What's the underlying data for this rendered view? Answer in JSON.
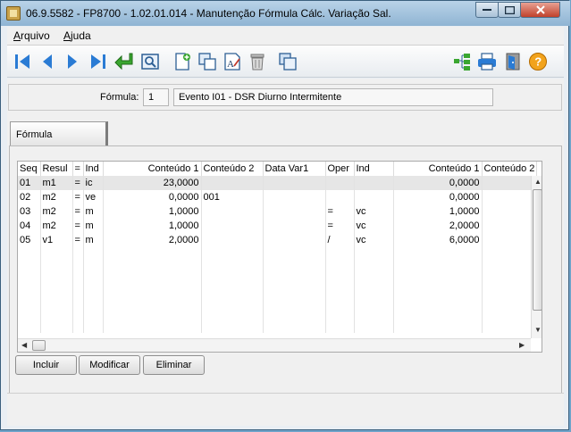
{
  "window": {
    "title": "06.9.5582 - FP8700 - 1.02.01.014 - Manutenção Fórmula Cálc. Variação Sal."
  },
  "menu": [
    {
      "label": "Arquivo"
    },
    {
      "label": "Ajuda"
    }
  ],
  "toolbar": {
    "icons": [
      "first-record-icon",
      "previous-record-icon",
      "next-record-icon",
      "last-record-icon",
      "goto-icon",
      "search-icon",
      "new-icon",
      "copy-icon",
      "edit-icon",
      "delete-icon",
      "duplicate-icon",
      "tree-icon",
      "print-icon",
      "exit-icon",
      "help-icon"
    ]
  },
  "header": {
    "formula_label": "Fórmula:",
    "formula_number": "1",
    "formula_description": "Evento I01 - DSR Diurno Intermitente"
  },
  "tab": {
    "label": "Fórmula"
  },
  "grid": {
    "columns": [
      "Seq",
      "Resul",
      "=",
      "Ind",
      "Conteúdo 1",
      "Conteúdo 2",
      "Data Var1",
      "Oper",
      "Ind",
      "Conteúdo 1",
      "Conteúdo 2"
    ],
    "rows": [
      [
        "01",
        "m1",
        "=",
        "ic",
        "23,0000",
        "",
        "",
        "",
        "",
        "0,0000",
        ""
      ],
      [
        "02",
        "m2",
        "=",
        "ve",
        "0,0000",
        "001",
        "",
        "",
        "",
        "0,0000",
        ""
      ],
      [
        "03",
        "m2",
        "=",
        "m",
        "1,0000",
        "",
        "",
        "=",
        "vc",
        "1,0000",
        ""
      ],
      [
        "04",
        "m2",
        "=",
        "m",
        "1,0000",
        "",
        "",
        "=",
        "vc",
        "2,0000",
        ""
      ],
      [
        "05",
        "v1",
        "=",
        "m",
        "2,0000",
        "",
        "",
        "/",
        "vc",
        "6,0000",
        ""
      ]
    ],
    "selected_row": 0
  },
  "buttons": {
    "add": "Incluir",
    "modify": "Modificar",
    "delete": "Eliminar"
  },
  "colors": {
    "accent": "#1e6fc8",
    "titlebar": "#a9c6df",
    "close": "#c7432d"
  }
}
